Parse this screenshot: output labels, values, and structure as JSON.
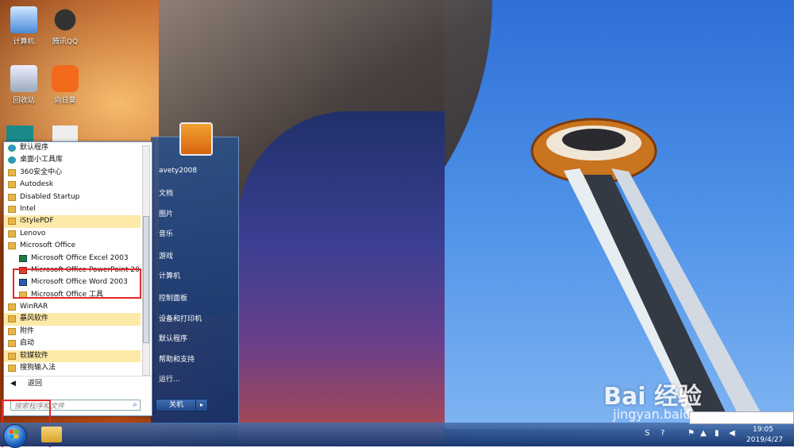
{
  "desktop": {
    "icons": [
      {
        "label": "计算机",
        "icon": "computer-icon"
      },
      {
        "label": "腾讯QQ",
        "icon": "qq-icon"
      },
      {
        "label": "回收站",
        "icon": "recycle-bin-icon"
      },
      {
        "label": "向日葵",
        "icon": "sunflower-icon"
      }
    ]
  },
  "start_menu": {
    "programs": [
      {
        "label": "默认程序",
        "icon": "default-programs-icon",
        "sub": false,
        "highlight": false
      },
      {
        "label": "桌面小工具库",
        "icon": "gadgets-icon",
        "sub": false,
        "highlight": false
      },
      {
        "label": "360安全中心",
        "icon": "folder-icon",
        "sub": false,
        "highlight": false
      },
      {
        "label": "Autodesk",
        "icon": "folder-icon",
        "sub": false,
        "highlight": false
      },
      {
        "label": "Disabled Startup",
        "icon": "folder-icon",
        "sub": false,
        "highlight": false
      },
      {
        "label": "Intel",
        "icon": "folder-icon",
        "sub": false,
        "highlight": false
      },
      {
        "label": "iStylePDF",
        "icon": "folder-icon",
        "sub": false,
        "highlight": true
      },
      {
        "label": "Lenovo",
        "icon": "folder-icon",
        "sub": false,
        "highlight": false
      },
      {
        "label": "Microsoft Office",
        "icon": "folder-icon",
        "sub": false,
        "highlight": false
      },
      {
        "label": "Microsoft Office Excel 2003",
        "icon": "excel-icon",
        "sub": true,
        "highlight": false
      },
      {
        "label": "Microsoft Office PowerPoint 20",
        "icon": "powerpoint-icon",
        "sub": true,
        "highlight": false
      },
      {
        "label": "Microsoft Office Word 2003",
        "icon": "word-icon",
        "sub": true,
        "highlight": false
      },
      {
        "label": "Microsoft Office 工具",
        "icon": "folder-icon",
        "sub": true,
        "highlight": false
      },
      {
        "label": "WinRAR",
        "icon": "folder-icon",
        "sub": false,
        "highlight": false
      },
      {
        "label": "暴风软件",
        "icon": "folder-icon",
        "sub": false,
        "highlight": true
      },
      {
        "label": "附件",
        "icon": "folder-icon",
        "sub": false,
        "highlight": false
      },
      {
        "label": "启动",
        "icon": "folder-icon",
        "sub": false,
        "highlight": false
      },
      {
        "label": "软媒软件",
        "icon": "folder-icon",
        "sub": false,
        "highlight": true
      },
      {
        "label": "搜狗输入法",
        "icon": "folder-icon",
        "sub": false,
        "highlight": false
      }
    ],
    "back_label": "返回",
    "search_placeholder": "搜索程序和文件",
    "user_name": "avety2008",
    "right_items": [
      "文档",
      "图片",
      "音乐",
      "游戏",
      "计算机",
      "控制面板",
      "设备和打印机",
      "默认程序",
      "帮助和支持",
      "运行..."
    ],
    "shutdown_label": "关机"
  },
  "taskbar": {
    "time": "19:05",
    "date": "2019/4/27"
  },
  "watermark": {
    "main": "Bai 经验",
    "sub": "jingyan.baidu.com"
  }
}
